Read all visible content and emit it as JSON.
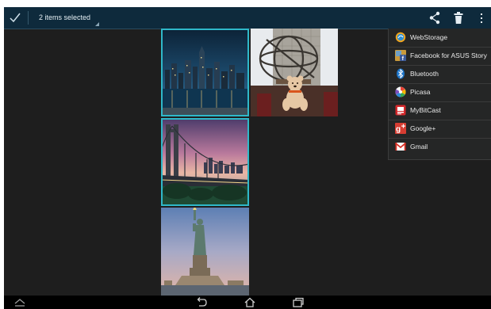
{
  "action_bar": {
    "selection_label": "2 items selected",
    "icons": [
      "check-icon",
      "share-icon",
      "trash-icon",
      "overflow-menu-icon"
    ],
    "accent_color": "#2fb8c9",
    "background_color": "#0e2a3c"
  },
  "share_menu": {
    "items": [
      {
        "label": "WebStorage",
        "icon": "webstorage-icon"
      },
      {
        "label": "Facebook for ASUS Story",
        "icon": "facebook-icon"
      },
      {
        "label": "Bluetooth",
        "icon": "bluetooth-icon"
      },
      {
        "label": "Picasa",
        "icon": "picasa-icon"
      },
      {
        "label": "MyBitCast",
        "icon": "mybitcast-icon"
      },
      {
        "label": "Google+",
        "icon": "google-plus-icon"
      },
      {
        "label": "Gmail",
        "icon": "gmail-icon"
      }
    ]
  },
  "gallery": {
    "photos": [
      {
        "name": "photo-city-skyline-night",
        "selected": true
      },
      {
        "name": "photo-atlas-statue-bear",
        "selected": false
      },
      {
        "name": "photo-bridge-sunset",
        "selected": true
      },
      {
        "name": "photo-statue-of-liberty",
        "selected": false
      }
    ]
  },
  "nav_bar": {
    "icons": [
      "collapse-up-icon",
      "back-icon",
      "home-icon",
      "recent-apps-icon"
    ]
  }
}
